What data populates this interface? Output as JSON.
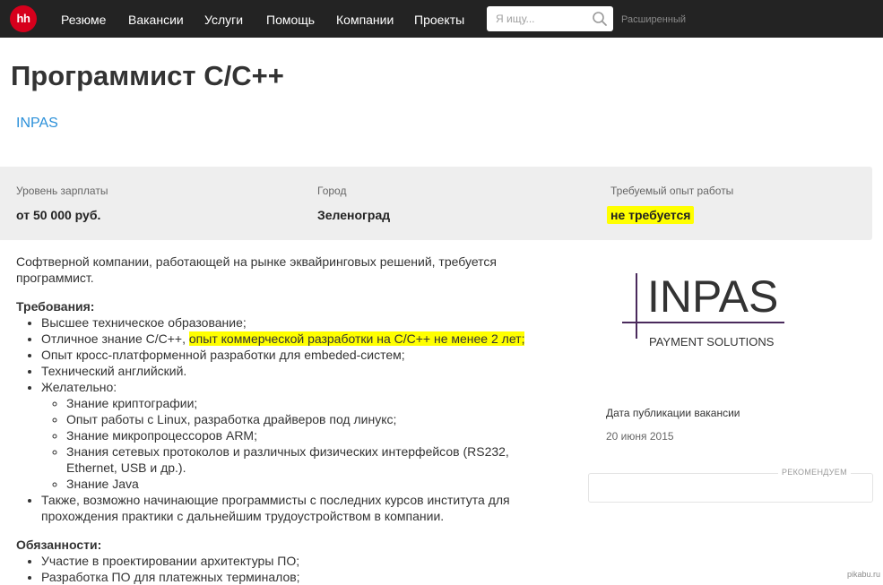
{
  "nav": {
    "logo": "hh",
    "items": [
      "Резюме",
      "Вакансии",
      "Услуги",
      "Помощь",
      "Компании",
      "Проекты"
    ],
    "search_placeholder": "Я ищу...",
    "advanced": "Расширенный"
  },
  "vacancy": {
    "title": "Программист C/C++",
    "company": "INPAS"
  },
  "info": {
    "salary_label": "Уровень зарплаты",
    "salary_value": "от 50 000 руб.",
    "city_label": "Город",
    "city_value": "Зеленоград",
    "experience_label": "Требуемый опыт работы",
    "experience_value": "не требуется"
  },
  "description": {
    "intro": "Софтверной компании, работающей на рынке эквайринговых решений, требуется программист.",
    "requirements_title": "Требования:",
    "req": {
      "education": "Высшее техническое образование;",
      "knowledge_lead": "Отличное знание C/C++, ",
      "knowledge_highlight": "опыт коммерческой разработки на C/C++ не менее 2 лет;",
      "crossplatform": "Опыт кросс-платформенной разработки для embeded-систем;",
      "english": "Технический английский.",
      "desirable": "Желательно:",
      "desirable_items": [
        "Знание криптографии;",
        "Опыт работы с Linux, разработка драйверов под линукс;",
        "Знание микропроцессоров ARM;",
        "Знания сетевых протоколов и различных физических интерфейсов (RS232, Ethernet, USB и др.).",
        "Знание Java"
      ],
      "beginners": "Также, возможно начинающие программисты с последних курсов института для прохождения практики с дальнейшим трудоустройством в компании."
    },
    "duties_title": "Обязанности:",
    "duties": [
      "Участие в проектировании архитектуры ПО;",
      "Разработка ПО для платежных терминалов;"
    ]
  },
  "sidebar": {
    "logo_text": "INPAS",
    "logo_subtitle": "PAYMENT SOLUTIONS",
    "logo_color": "#4a2a5c",
    "publication_label": "Дата публикации вакансии",
    "publication_date": "20 июня 2015",
    "recommended_label": "РЕКОМЕНДУЕМ"
  },
  "watermark": "pikabu.ru",
  "colors": {
    "topbar": "#232323",
    "logo": "#d6001c",
    "link": "#2b90d9",
    "highlight": "#ffff00",
    "info_band": "#eeeeee"
  }
}
